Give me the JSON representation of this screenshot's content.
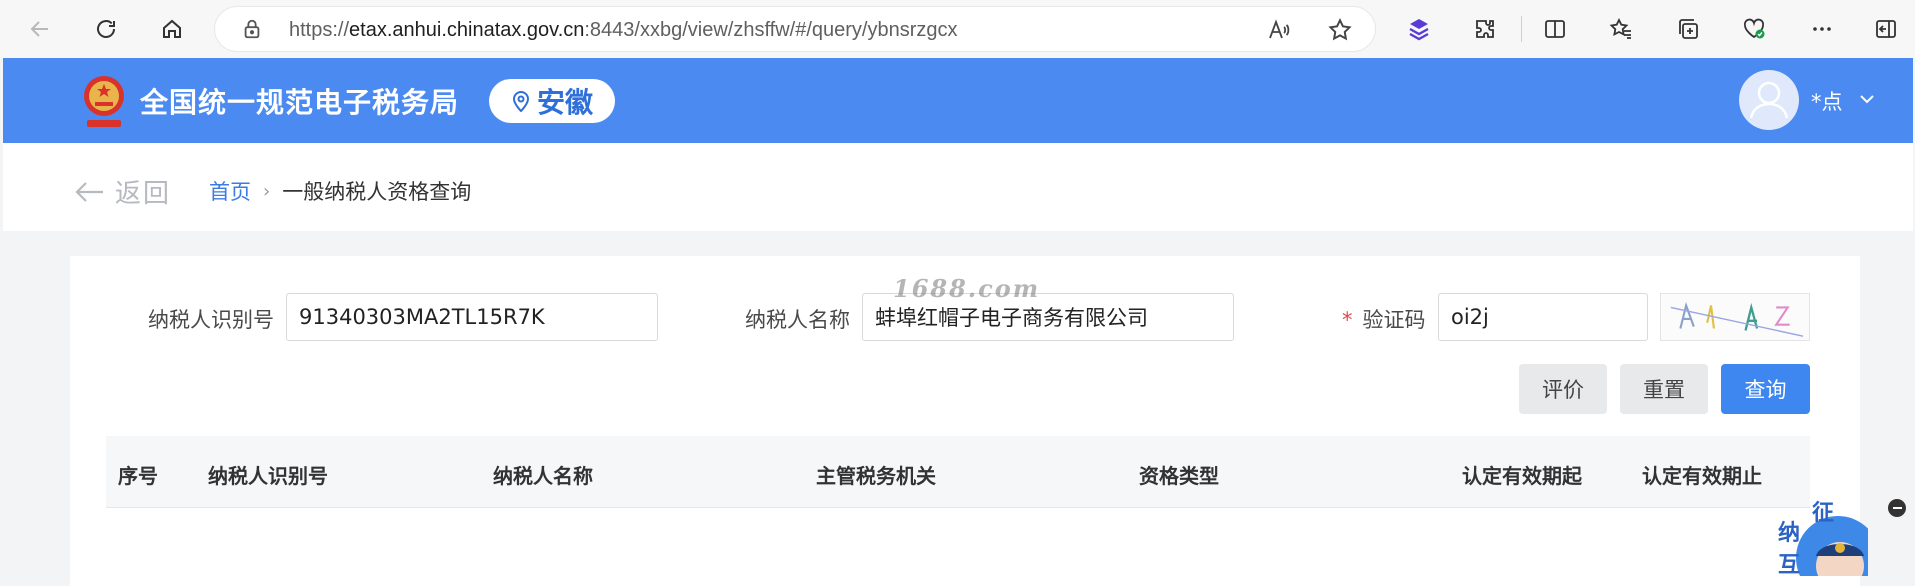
{
  "browser": {
    "url_prefix": "https://",
    "url_host": "etax.anhui.chinatax.gov.cn",
    "url_rest": ":8443/xxbg/view/zhsffw/#/query/ybnsrzgcx"
  },
  "header": {
    "site_title": "全国统一规范电子税务局",
    "region": "安徽",
    "user_name": "*点"
  },
  "breadcrumb": {
    "back_label": "返回",
    "home": "首页",
    "separator": "›",
    "current": "一般纳税人资格查询"
  },
  "form": {
    "taxpayer_id_label": "纳税人识别号",
    "taxpayer_id_value": "91340303MA2TL15R7K",
    "taxpayer_name_label": "纳税人名称",
    "taxpayer_name_value": "蚌埠红帽子电子商务有限公司",
    "captcha_required_mark": "*",
    "captcha_label": "验证码",
    "captcha_value": "oi2j"
  },
  "buttons": {
    "evaluate": "评价",
    "reset": "重置",
    "query": "查询"
  },
  "table": {
    "columns": [
      "序号",
      "纳税人识别号",
      "纳税人名称",
      "主管税务机关",
      "资格类型",
      "认定有效期起",
      "认定有效期止"
    ]
  },
  "watermark": "1688.com",
  "colors": {
    "header_blue": "#4a8af1",
    "primary_button": "#3f87f0",
    "link_blue": "#3c7be6",
    "required_red": "#e24a4a"
  }
}
